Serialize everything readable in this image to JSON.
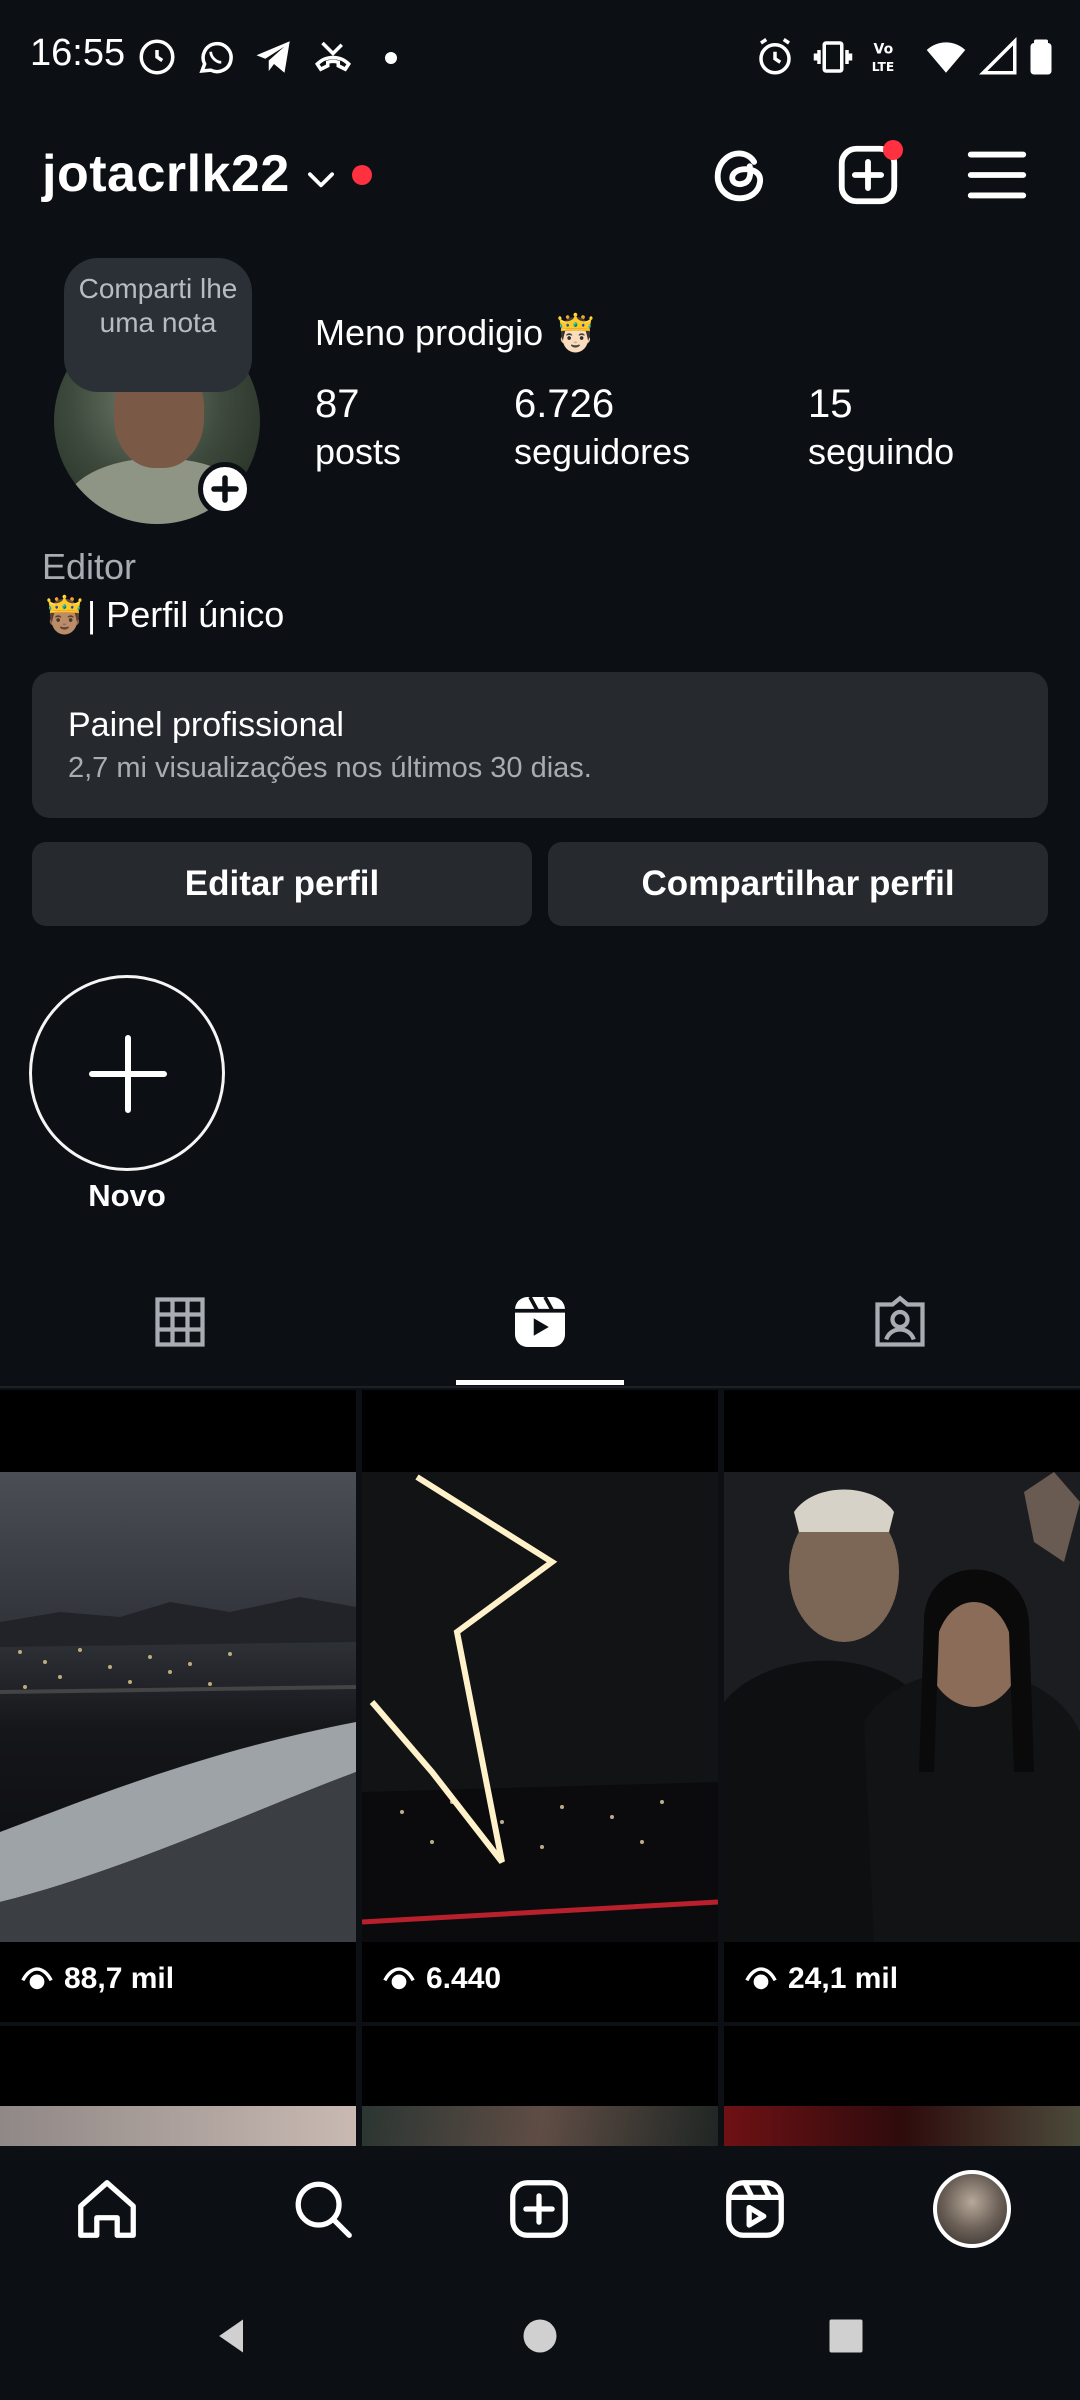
{
  "status_bar": {
    "time": "16:55",
    "icons_left": [
      "threads-notification-icon",
      "whatsapp-icon",
      "telegram-icon",
      "missed-call-icon",
      "dot"
    ],
    "icons_right": [
      "alarm-icon",
      "vibrate-icon",
      "volte-icon",
      "wifi-icon",
      "signal-icon",
      "battery-icon"
    ]
  },
  "header": {
    "username": "jotacrlk22",
    "has_notification_dot": true,
    "actions": [
      "threads-icon",
      "create-icon",
      "menu-icon"
    ]
  },
  "profile": {
    "note_bubble": "Comparti lhe uma nota",
    "display_name": "Meno prodigio 🤴🏻",
    "stats": [
      {
        "value": "87",
        "label": "posts"
      },
      {
        "value": "6.726",
        "label": "seguidores"
      },
      {
        "value": "15",
        "label": "seguindo"
      }
    ],
    "category": "Editor",
    "bio": "🤴🏽| Perfil único"
  },
  "dashboard": {
    "title": "Painel profissional",
    "subtitle": "2,7 mi visualizações nos últimos 30 dias."
  },
  "buttons": {
    "edit_profile": "Editar perfil",
    "share_profile": "Compartilhar perfil"
  },
  "highlights": {
    "new_label": "Novo"
  },
  "tabs": {
    "items": [
      "grid-icon",
      "reels-icon",
      "tagged-icon"
    ],
    "active": "reels"
  },
  "reels": [
    {
      "views": "88,7 mil"
    },
    {
      "views": "6.440"
    },
    {
      "views": "24,1 mil"
    }
  ],
  "bottom_nav": [
    "home-icon",
    "search-icon",
    "create-icon",
    "reels-icon",
    "profile-avatar"
  ],
  "colors": {
    "background": "#0c1014",
    "surface": "#262a2f",
    "notification_red": "#ff3040",
    "muted_text": "#a8adb3"
  }
}
